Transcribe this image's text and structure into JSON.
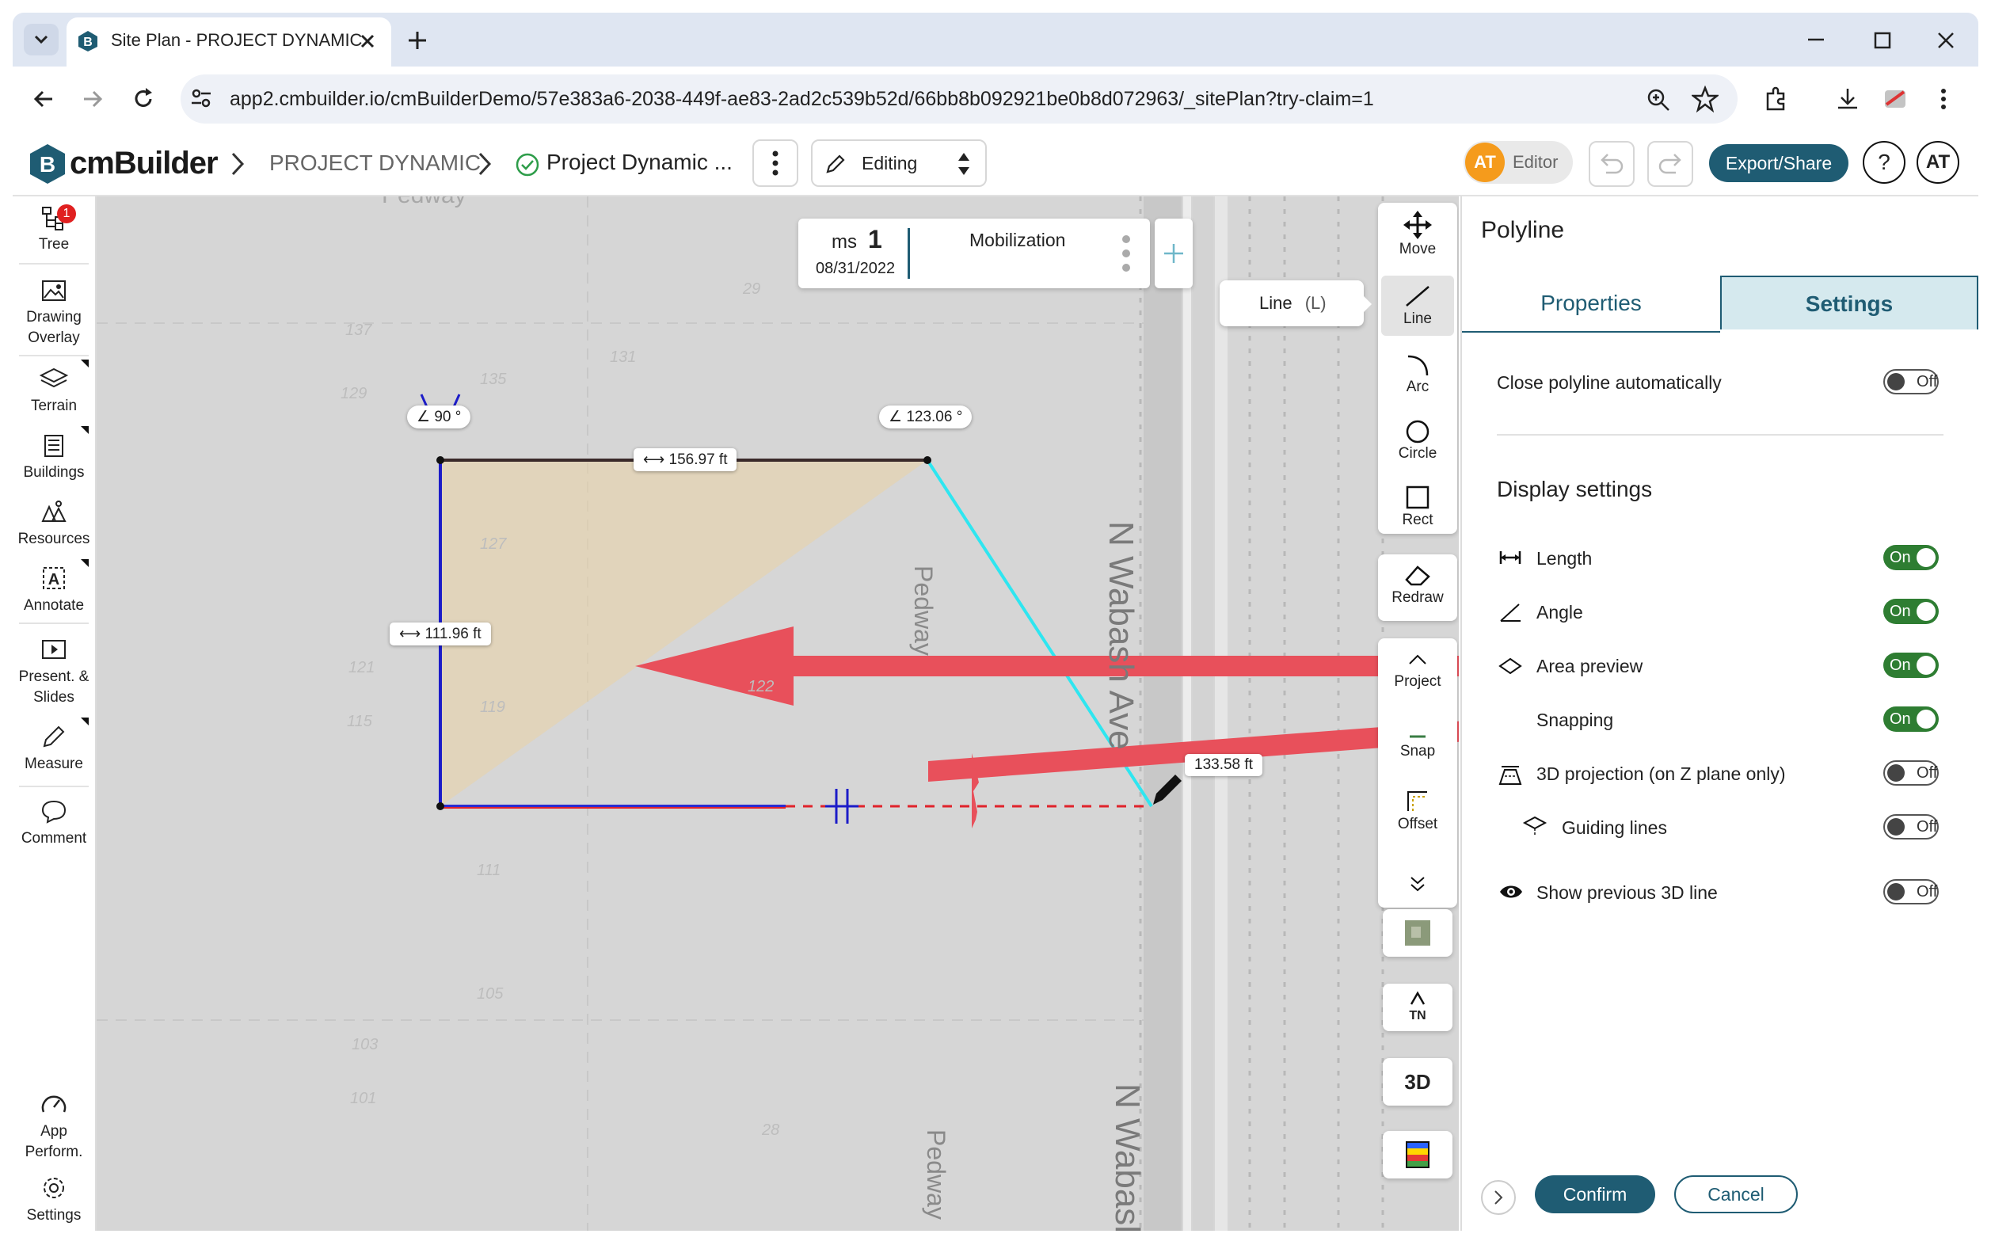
{
  "browser": {
    "tab_title": "Site Plan - PROJECT DYNAMIC |",
    "url": "app2.cmbuilder.io/cmBuilderDemo/57e383a6-2038-449f-ae83-2ad2c539b52d/66bb8b092921be0b8d072963/_sitePlan?try-claim=1"
  },
  "header": {
    "logo_text": "cmBuilder",
    "breadcrumb_project": "PROJECT DYNAMIC",
    "breadcrumb_plan": "Project Dynamic ...",
    "mode": "Editing",
    "user_initials": "AT",
    "role": "Editor",
    "export_label": "Export/Share",
    "help": "?",
    "avatar": "AT"
  },
  "sidebar": {
    "tree": "Tree",
    "tree_badge": "1",
    "drawing_overlay_1": "Drawing",
    "drawing_overlay_2": "Overlay",
    "terrain": "Terrain",
    "buildings": "Buildings",
    "resources": "Resources",
    "annotate": "Annotate",
    "present_1": "Present. &",
    "present_2": "Slides",
    "measure": "Measure",
    "comment": "Comment",
    "app_perf_1": "App",
    "app_perf_2": "Perform.",
    "settings": "Settings"
  },
  "milestone": {
    "prefix": "ms",
    "number": "1",
    "date": "08/31/2022",
    "name": "Mobilization"
  },
  "tooltip": {
    "label": "Line",
    "shortcut": "(L)"
  },
  "tools": {
    "move": "Move",
    "line": "Line",
    "arc": "Arc",
    "circle": "Circle",
    "rect": "Rect",
    "redraw": "Redraw",
    "project": "Project",
    "snap": "Snap",
    "offset": "Offset",
    "north": "TN",
    "three_d": "3D"
  },
  "map": {
    "angle_left": "90 °",
    "angle_right": "123.06 °",
    "len_top": "156.97  ft",
    "len_left": "111.96  ft",
    "len_diag": "133.58  ft",
    "street_main": "N Wabash Ave",
    "street_bottom": "N Wabash",
    "pedway_1": "Pedway",
    "pedway_2": "Pedway",
    "pedway_top": "Pedway",
    "grid_numbers": [
      "137",
      "135",
      "131",
      "129",
      "127",
      "121",
      "119",
      "115",
      "111",
      "105",
      "103",
      "101",
      "29",
      "28",
      "122"
    ]
  },
  "panel": {
    "title": "Polyline",
    "tab_properties": "Properties",
    "tab_settings": "Settings",
    "close_auto": "Close polyline automatically",
    "close_auto_state": "Off",
    "display_heading": "Display settings",
    "rows": [
      {
        "label": "Length",
        "state": "On"
      },
      {
        "label": "Angle",
        "state": "On"
      },
      {
        "label": "Area preview",
        "state": "On"
      },
      {
        "label": "Snapping",
        "state": "On"
      },
      {
        "label": "3D projection (on Z plane only)",
        "state": "Off"
      },
      {
        "label": "Guiding lines",
        "state": "Off"
      },
      {
        "label": "Show previous 3D line",
        "state": "Off"
      }
    ],
    "confirm": "Confirm",
    "cancel": "Cancel"
  },
  "colors": {
    "accent": "#1f5c73",
    "toggle_on": "#2e7d32",
    "annotation_arrow": "#e8505b",
    "line_cyan": "#2ee6f0",
    "line_blue": "#1c1cc8",
    "line_red": "#e0232b",
    "area_fill": "#e8d2a8"
  }
}
